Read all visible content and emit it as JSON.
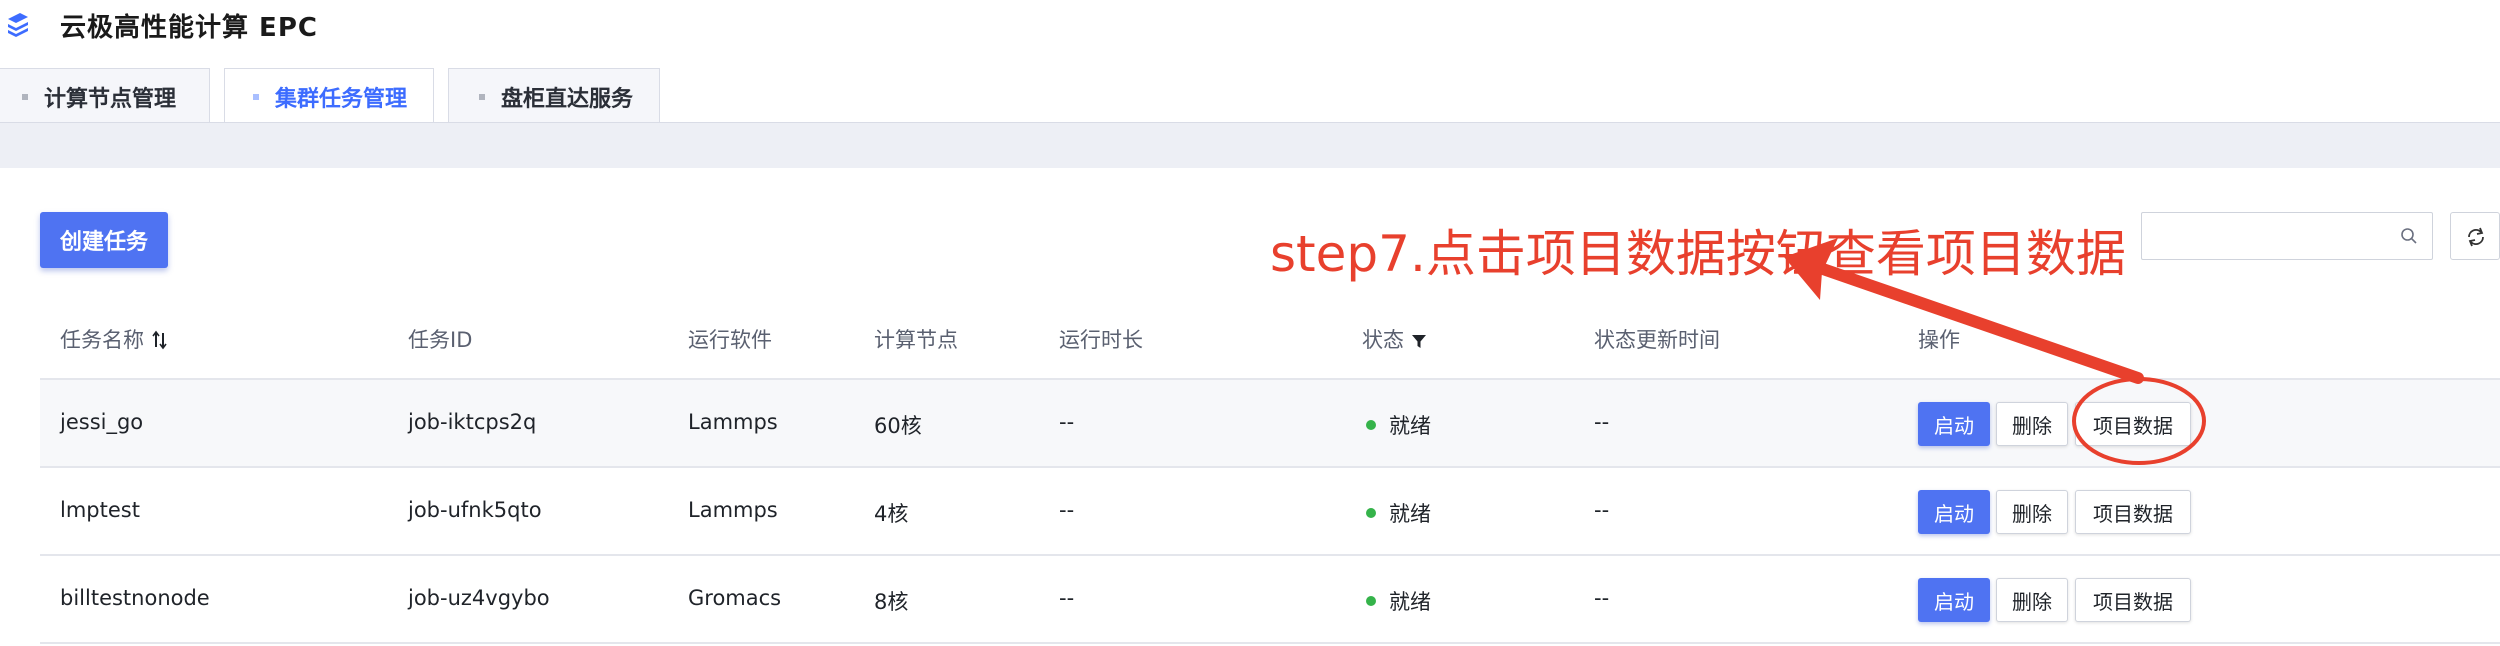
{
  "app": {
    "title": "云极高性能计算 EPC",
    "logo_icon": "layers-logo-icon"
  },
  "tabs": [
    {
      "label": "计算节点管理",
      "active": false
    },
    {
      "label": "集群任务管理",
      "active": true
    },
    {
      "label": "盘柜直达服务",
      "active": false
    }
  ],
  "toolbar": {
    "create_label": "创建任务",
    "search_placeholder": "",
    "search_icon": "search-icon",
    "refresh_icon": "refresh-icon"
  },
  "annotation": {
    "text": "step7.点击项目数据按钮查看项目数据",
    "color": "#e8402d"
  },
  "table": {
    "headers": {
      "name": "任务名称",
      "id": "任务ID",
      "software": "运行软件",
      "nodes": "计算节点",
      "duration": "运行时长",
      "status": "状态",
      "updated": "状态更新时间",
      "actions": "操作"
    },
    "rows": [
      {
        "name": "jessi_go",
        "id": "job-iktcps2q",
        "software": "Lammps",
        "nodes": "60核",
        "duration": "--",
        "status": "就绪",
        "updated": "--"
      },
      {
        "name": "lmptest",
        "id": "job-ufnk5qto",
        "software": "Lammps",
        "nodes": "4核",
        "duration": "--",
        "status": "就绪",
        "updated": "--"
      },
      {
        "name": "billtestnonode",
        "id": "job-uz4vgybo",
        "software": "Gromacs",
        "nodes": "8核",
        "duration": "--",
        "status": "就绪",
        "updated": "--"
      }
    ],
    "actions": {
      "start": "启动",
      "delete": "删除",
      "data": "项目数据"
    }
  },
  "colors": {
    "primary": "#4f73f2",
    "active_tab": "#3d6cff",
    "status_ready": "#35b34a",
    "annotation": "#e8402d"
  }
}
